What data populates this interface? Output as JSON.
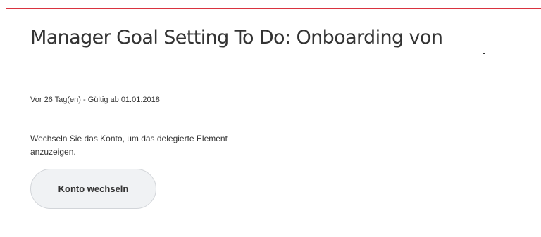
{
  "task": {
    "title": "Manager Goal Setting To Do: Onboarding von",
    "meta": "Vor 26 Tag(en) -  Gültig ab 01.01.2018",
    "message": "Wechseln Sie das Konto, um das delegierte Element anzuzeigen.",
    "switch_account_label": "Konto wechseln"
  },
  "colors": {
    "frame_border": "#d9333f",
    "button_bg": "#f0f2f4",
    "text": "#333333"
  }
}
